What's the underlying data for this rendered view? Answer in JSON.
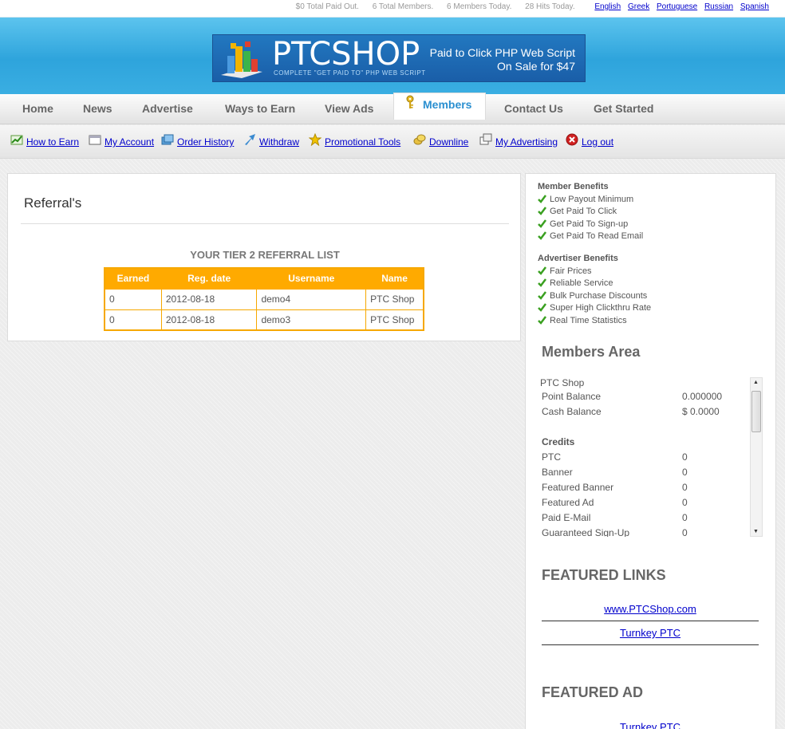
{
  "topbar": {
    "stats": [
      "$0 Total Paid Out.",
      "6 Total Members.",
      "6 Members Today.",
      "28 Hits Today."
    ],
    "languages": [
      "English",
      "Greek",
      "Portuguese",
      "Russian",
      "Spanish"
    ]
  },
  "banner": {
    "brand": "PTCSHOP",
    "tagline": "COMPLETE \"GET PAID TO\" PHP WEB SCRIPT",
    "promo_line1": "Paid to Click PHP Web Script",
    "promo_line2": "On Sale for $47"
  },
  "nav": {
    "items": [
      "Home",
      "News",
      "Advertise",
      "Ways to Earn",
      "View Ads",
      "Members",
      "Contact Us",
      "Get Started"
    ],
    "active": "Members"
  },
  "subnav": {
    "items": [
      "How to Earn",
      "My Account",
      "Order History",
      "Withdraw",
      "Promotional Tools",
      "Downline",
      "My Advertising",
      "Log out"
    ]
  },
  "content": {
    "title": "Referral's",
    "list_title": "YOUR TIER 2 REFERRAL LIST",
    "columns": [
      "Earned",
      "Reg. date",
      "Username",
      "Name"
    ],
    "rows": [
      [
        "0",
        "2012-08-18",
        "demo4",
        "PTC Shop"
      ],
      [
        "0",
        "2012-08-18",
        "demo3",
        "PTC Shop"
      ]
    ]
  },
  "sidebar": {
    "member_benefits_title": "Member Benefits",
    "member_benefits": [
      "Low Payout Minimum",
      "Get Paid To Click",
      "Get Paid To Sign-up",
      "Get Paid To Read Email"
    ],
    "advertiser_benefits_title": "Advertiser Benefits",
    "advertiser_benefits": [
      "Fair Prices",
      "Reliable Service",
      "Bulk Purchase Discounts",
      "Super High Clickthru Rate",
      "Real Time Statistics"
    ],
    "members_area_title": "Members Area",
    "member_name": "PTC Shop",
    "point_balance_label": "Point Balance",
    "point_balance": "0.000000",
    "cash_balance_label": "Cash Balance",
    "cash_balance": "$ 0.0000",
    "credits_title": "Credits",
    "credits": [
      {
        "label": "PTC",
        "value": "0"
      },
      {
        "label": "Banner",
        "value": "0"
      },
      {
        "label": "Featured Banner",
        "value": "0"
      },
      {
        "label": "Featured Ad",
        "value": "0"
      },
      {
        "label": "Paid E-Mail",
        "value": "0"
      },
      {
        "label": "Guaranteed Sign-Up",
        "value": "0"
      }
    ],
    "featured_links_title": "FEATURED LINKS",
    "featured_links": [
      "www.PTCShop.com",
      "Turnkey PTC"
    ],
    "featured_ad_title": "FEATURED AD",
    "featured_ad_link": "Turnkey PTC"
  },
  "colors": {
    "accent": "#2a8fd0",
    "table_header": "#ffaa00",
    "header_blue": "#2ea4dc",
    "link": "#0000cc"
  }
}
